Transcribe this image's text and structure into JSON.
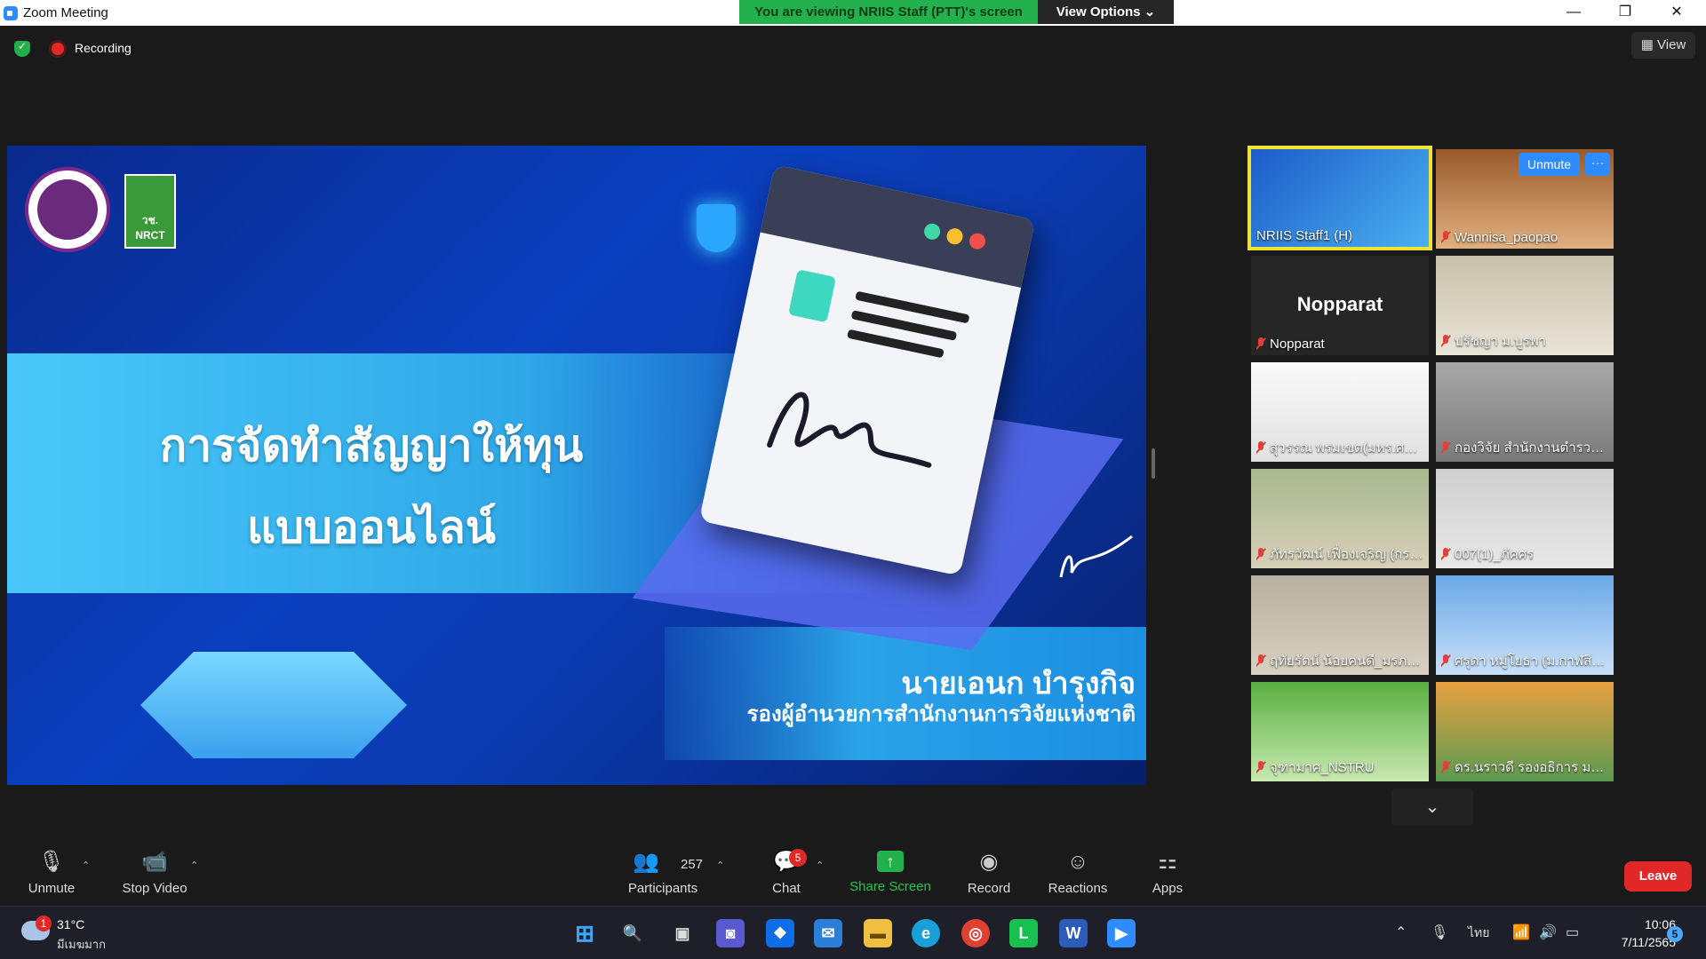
{
  "window": {
    "title": "Zoom Meeting",
    "minimize": "—",
    "restore": "❐",
    "close": "✕"
  },
  "banner": {
    "viewing": "You are viewing NRIIS Staff (PTT)'s screen",
    "view_options": "View Options ⌄"
  },
  "meeting": {
    "recording_label": "Recording",
    "view_label": "▦ View"
  },
  "slide": {
    "title_line1": "การจัดทำสัญญาให้ทุน",
    "title_line2": "แบบออนไลน์",
    "speaker_name": "นายเอนก บำรุงกิจ",
    "speaker_title": "รองผู้อำนวยการสำนักงานการวิจัยแห่งชาติ",
    "logo_text": "วช. NRCT"
  },
  "participants_grid": [
    {
      "name": "NRIIS Staff1 (H)",
      "muted": false,
      "active": true
    },
    {
      "name": "Wannisa_paopao",
      "muted": true,
      "active": false,
      "unmute_label": "Unmute",
      "more_label": "···"
    },
    {
      "name": "Nopparat",
      "muted": true,
      "active": false,
      "display": "Nopparat"
    },
    {
      "name": "ปรัชญา ม.บูรพา",
      "muted": true,
      "active": false
    },
    {
      "name": "สุวรรณ พรมเขต(มหร.ศรีวิ...",
      "muted": true,
      "active": false
    },
    {
      "name": "กองวิจัย สำนักงานตำรวจแ...",
      "muted": true,
      "active": false
    },
    {
      "name": "ภัทรวัฒน์ เฟื่องเจริญ (กรม...",
      "muted": true,
      "active": false
    },
    {
      "name": "007(1)_ภัคศร",
      "muted": true,
      "active": false
    },
    {
      "name": "ฤทัยรัตน์ น้อยคนดี_มรภ.ก...",
      "muted": true,
      "active": false
    },
    {
      "name": "ศรุดา หมู่โยธา (ม.กาฬสินธุ์)",
      "muted": true,
      "active": false
    },
    {
      "name": "จุฑามาศ_NSTRU",
      "muted": true,
      "active": false
    },
    {
      "name": "ดร.นราวดี รองอธิการ มรภ....",
      "muted": true,
      "active": false
    }
  ],
  "toolbar": {
    "unmute": "Unmute",
    "stop_video": "Stop Video",
    "participants": "Participants",
    "participants_count": "257",
    "chat": "Chat",
    "chat_badge": "5",
    "share_screen": "Share Screen",
    "record": "Record",
    "reactions": "Reactions",
    "apps": "Apps",
    "leave": "Leave"
  },
  "taskbar": {
    "weather_temp": "31°C",
    "weather_desc": "มีเมฆมาก",
    "weather_badge": "1",
    "lang": "ไทย",
    "time": "10:06",
    "date": "7/11/2565",
    "notifications": "5"
  },
  "colors": {
    "accent": "#2d8cff",
    "banner_green": "#23b14d",
    "leave_red": "#e02828",
    "active_tile": "#f2e232"
  }
}
